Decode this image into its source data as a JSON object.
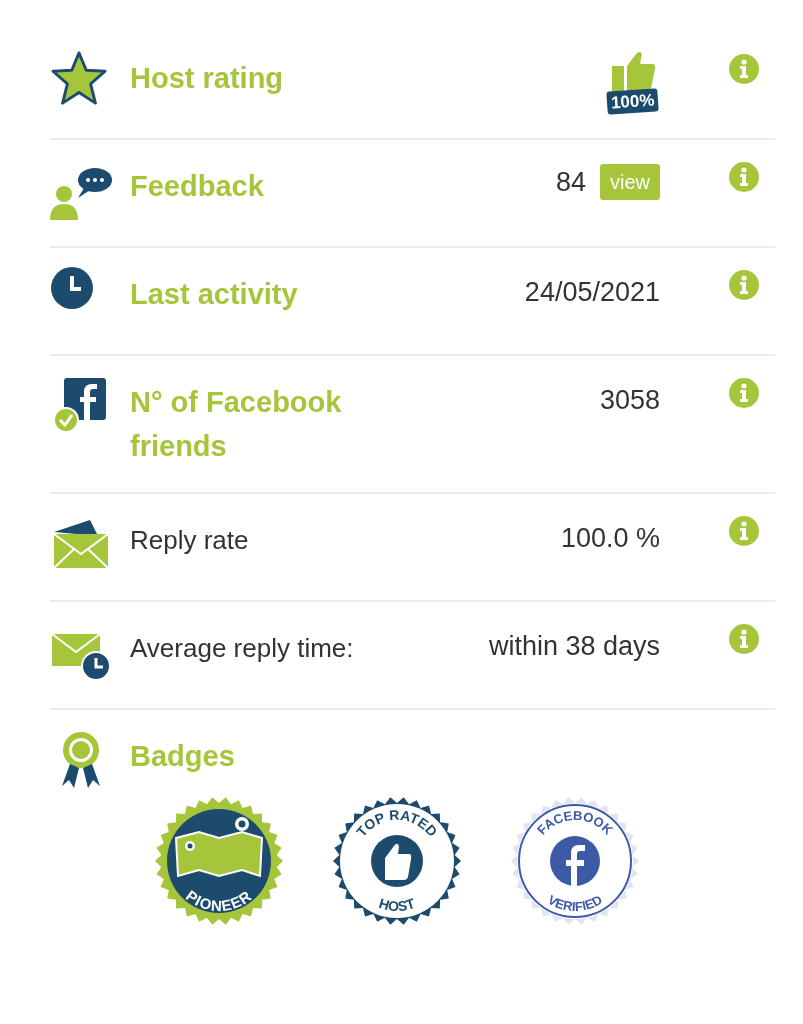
{
  "rows": [
    {
      "label": "Host rating",
      "highlight": true,
      "kind": "rating",
      "rating_label": "100%"
    },
    {
      "label": "Feedback",
      "highlight": true,
      "kind": "count_button",
      "value": "84",
      "button": "view"
    },
    {
      "label": "Last activity",
      "highlight": true,
      "kind": "text",
      "value": "24/05/2021"
    },
    {
      "label": "N° of Facebook friends",
      "highlight": true,
      "kind": "text",
      "value": "3058"
    },
    {
      "label": "Reply rate",
      "highlight": false,
      "kind": "text",
      "value": "100.0 %"
    },
    {
      "label": "Average reply time:",
      "highlight": false,
      "kind": "text",
      "value": "within 38 days"
    }
  ],
  "badges": {
    "label": "Badges",
    "items": [
      {
        "kind": "pioneer",
        "bottom": "PIONEER"
      },
      {
        "kind": "top_rated",
        "top": "TOP RATED",
        "bottom": "HOST"
      },
      {
        "kind": "facebook",
        "top": "FACEBOOK",
        "bottom": "VERIFIED"
      }
    ]
  }
}
